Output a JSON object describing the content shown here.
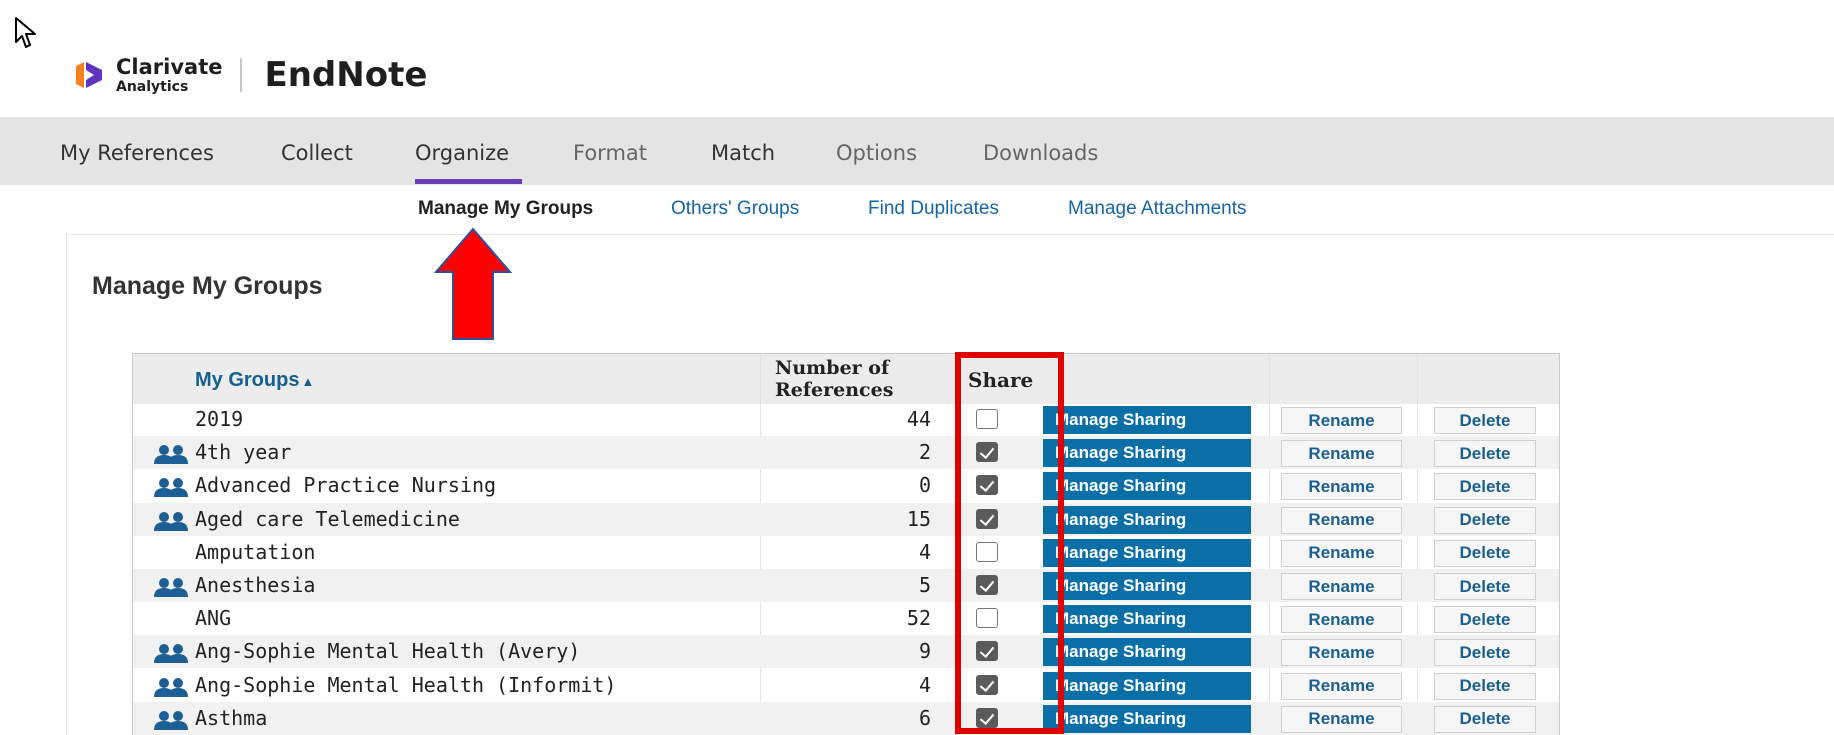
{
  "header": {
    "brand_name": "Clarivate",
    "brand_sub": "Analytics",
    "product": "EndNote"
  },
  "nav": {
    "items": [
      {
        "label": "My References"
      },
      {
        "label": "Collect"
      },
      {
        "label": "Organize"
      },
      {
        "label": "Format"
      },
      {
        "label": "Match"
      },
      {
        "label": "Options"
      },
      {
        "label": "Downloads"
      }
    ],
    "active": "Organize"
  },
  "subnav": {
    "items": [
      {
        "label": "Manage My Groups"
      },
      {
        "label": "Others' Groups"
      },
      {
        "label": "Find Duplicates"
      },
      {
        "label": "Manage Attachments"
      }
    ],
    "active": "Manage My Groups"
  },
  "page": {
    "title": "Manage My Groups"
  },
  "table": {
    "col_groups": "My Groups",
    "sort_indicator": "▲",
    "col_number_line1": "Number of",
    "col_number_line2": "References",
    "col_share": "Share",
    "rows": [
      {
        "name": "2019",
        "count": "44",
        "shared": false
      },
      {
        "name": "4th year",
        "count": "2",
        "shared": true
      },
      {
        "name": "Advanced Practice Nursing",
        "count": "0",
        "shared": true
      },
      {
        "name": "Aged care Telemedicine",
        "count": "15",
        "shared": true
      },
      {
        "name": "Amputation",
        "count": "4",
        "shared": false
      },
      {
        "name": "Anesthesia",
        "count": "5",
        "shared": true
      },
      {
        "name": "ANG",
        "count": "52",
        "shared": false
      },
      {
        "name": "Ang-Sophie Mental Health (Avery)",
        "count": "9",
        "shared": true
      },
      {
        "name": "Ang-Sophie Mental Health (Informit)",
        "count": "4",
        "shared": true
      },
      {
        "name": "Asthma",
        "count": "6",
        "shared": true
      }
    ],
    "buttons": {
      "manage_sharing": "Manage Sharing",
      "rename": "Rename",
      "delete": "Delete"
    }
  },
  "colors": {
    "accent": "#6a3db8",
    "link": "#1366a4",
    "share_button": "#0b6fa7",
    "annotation": "#e00000",
    "logo_orange": "#f5821f",
    "logo_purple": "#5e33bf"
  },
  "icons": {
    "cursor": "mouse-pointer-icon",
    "logo": "clarivate-logo-icon",
    "group": "users-icon",
    "annotation": "red-up-arrow"
  }
}
